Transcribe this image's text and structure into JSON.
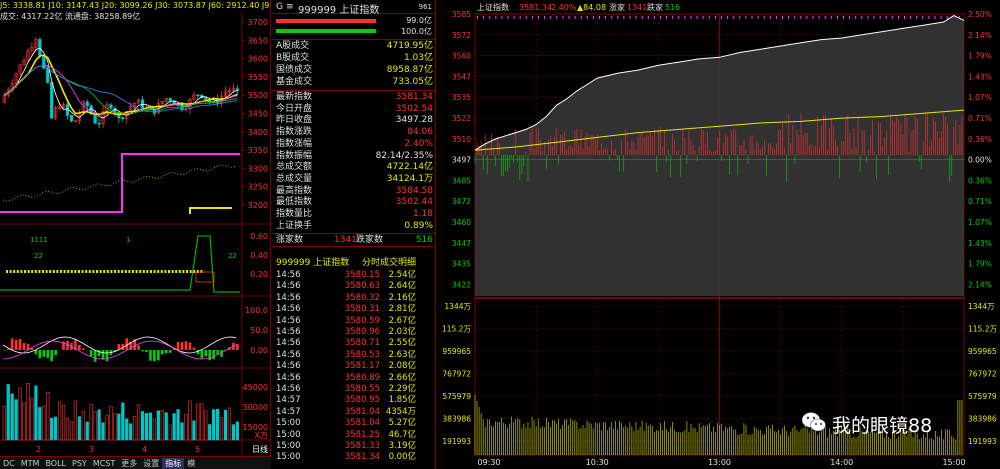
{
  "left": {
    "header_line1": "J5: 3338.81  J10: 3147.43  J20: 3099.26  J30: 3073.87  J60: 2912.40  J9",
    "header_line2": "成交: 4317.22亿 流通盘: 38258.89亿",
    "price_ticks": [
      "3700",
      "3650",
      "3600",
      "3550",
      "3500",
      "3450",
      "3400",
      "3350",
      "3300",
      "3250",
      "3200"
    ],
    "ind1_ticks": [
      "0.60",
      "0.40",
      "0.20"
    ],
    "ind1_labels": [
      "1111",
      "1",
      "22",
      "22"
    ],
    "ind2_ticks": [
      "100.0",
      "50.0",
      "0.00"
    ],
    "vol_ticks": [
      "45000",
      "30000",
      "15000"
    ],
    "vol_unit": "X万",
    "date_labels": [
      "2",
      "3",
      "4",
      "5"
    ],
    "side_label": "日线",
    "toolbar": [
      "DC",
      "MTM",
      "BOLL",
      "PSY",
      "MCST",
      "更多",
      "设置",
      "指标",
      "模"
    ]
  },
  "mid": {
    "code_title": "999999 上证指数",
    "badge": "G",
    "side_badge": "961",
    "bar_values": [
      "99.0亿",
      "100.0亿"
    ],
    "stats": [
      {
        "label": "A股成交",
        "value": "4719.95亿",
        "color": "yellow"
      },
      {
        "label": "B股成交",
        "value": "1.03亿",
        "color": "yellow"
      },
      {
        "label": "国债成交",
        "value": "8958.87亿",
        "color": "yellow"
      },
      {
        "label": "基金成交",
        "value": "733.05亿",
        "color": "yellow"
      }
    ],
    "quote": [
      {
        "label": "最新指数",
        "value": "3581.34",
        "color": "red"
      },
      {
        "label": "今日开盘",
        "value": "3502.54",
        "color": "red"
      },
      {
        "label": "昨日收盘",
        "value": "3497.28",
        "color": "white"
      },
      {
        "label": "指数涨跌",
        "value": "84.06",
        "color": "red"
      },
      {
        "label": "指数涨幅",
        "value": "2.40%",
        "color": "red"
      },
      {
        "label": "指数振幅",
        "value": "82.14/2.35%",
        "color": "white"
      },
      {
        "label": "总成交额",
        "value": "4722.14亿",
        "color": "yellow"
      },
      {
        "label": "总成交量",
        "value": "34124.1万",
        "color": "yellow"
      },
      {
        "label": "最高指数",
        "value": "3584.58",
        "color": "red"
      },
      {
        "label": "最低指数",
        "value": "3502.44",
        "color": "red"
      },
      {
        "label": "指数量比",
        "value": "1.18",
        "color": "red"
      },
      {
        "label": "上证换手",
        "value": "0.89%",
        "color": "yellow"
      }
    ],
    "updown": {
      "up_label": "涨家数",
      "up_value": "1341",
      "down_label": "跌家数",
      "down_value": "516"
    },
    "detail_title": "999999 上证指数",
    "detail_subtitle": "分时成交明细",
    "ticks": [
      {
        "t": "14:56",
        "p": "3580.15",
        "v": "2.54亿"
      },
      {
        "t": "14:56",
        "p": "3580.63",
        "v": "2.64亿"
      },
      {
        "t": "14:56",
        "p": "3580.32",
        "v": "2.16亿"
      },
      {
        "t": "14:56",
        "p": "3580.31",
        "v": "2.81亿"
      },
      {
        "t": "14:56",
        "p": "3580.59",
        "v": "2.67亿"
      },
      {
        "t": "14:56",
        "p": "3580.96",
        "v": "2.03亿"
      },
      {
        "t": "14:56",
        "p": "3580.71",
        "v": "2.55亿"
      },
      {
        "t": "14:56",
        "p": "3580.53",
        "v": "2.63亿"
      },
      {
        "t": "14:56",
        "p": "3581.17",
        "v": "2.08亿"
      },
      {
        "t": "14:56",
        "p": "3580.89",
        "v": "2.66亿"
      },
      {
        "t": "14:56",
        "p": "3580.55",
        "v": "2.29亿"
      },
      {
        "t": "14:57",
        "p": "3580.95",
        "v": "1.85亿"
      },
      {
        "t": "14:57",
        "p": "3581.04",
        "v": "4354万"
      },
      {
        "t": "15:00",
        "p": "3581.04",
        "v": "5.27亿"
      },
      {
        "t": "15:00",
        "p": "3581.25",
        "v": "46.7亿"
      },
      {
        "t": "15:00",
        "p": "3581.33",
        "v": "3.19亿"
      },
      {
        "t": "15:00",
        "p": "3581.34",
        "v": "0.00亿"
      }
    ]
  },
  "chart_data": {
    "type": "line",
    "title": "上证指数",
    "header": {
      "name": "上证指数",
      "last": "3581.34",
      "pct": "2.40%",
      "chg": "84.08",
      "up_label": "涨家",
      "up": "1341",
      "down_label": "跌家",
      "down": "516"
    },
    "prev_close": 3497,
    "y_left_ticks": [
      "3585",
      "3572",
      "3560",
      "3547",
      "3535",
      "3522",
      "3510",
      "3497",
      "3485",
      "3472",
      "3460",
      "3447",
      "3435",
      "3422"
    ],
    "y_right_ticks": [
      "2.50%",
      "2.14%",
      "1.79%",
      "1.43%",
      "1.07%",
      "0.71%",
      "0.36%",
      "0.00%",
      "0.36%",
      "0.71%",
      "1.07%",
      "1.43%",
      "1.79%",
      "2.14%"
    ],
    "ylim": [
      3409,
      3585
    ],
    "vol_ticks": [
      "1344万",
      "115.2万",
      "959965",
      "767972",
      "575979",
      "383986",
      "191993"
    ],
    "x_labels": [
      "09:30",
      "10:30",
      "13:00",
      "14:00",
      "15:00"
    ],
    "series": [
      {
        "color": "#ffffff",
        "points": [
          [
            0,
            3500
          ],
          [
            5,
            3504
          ],
          [
            10,
            3507
          ],
          [
            15,
            3509
          ],
          [
            20,
            3511
          ],
          [
            25,
            3513
          ],
          [
            30,
            3516
          ],
          [
            35,
            3521
          ],
          [
            40,
            3528
          ],
          [
            45,
            3532
          ],
          [
            50,
            3537
          ],
          [
            55,
            3541
          ],
          [
            60,
            3545
          ],
          [
            70,
            3548
          ],
          [
            80,
            3550
          ],
          [
            90,
            3553
          ],
          [
            100,
            3555
          ],
          [
            110,
            3557
          ],
          [
            120,
            3558
          ],
          [
            130,
            3561
          ],
          [
            140,
            3563
          ],
          [
            150,
            3565
          ],
          [
            160,
            3567
          ],
          [
            170,
            3569
          ],
          [
            180,
            3570
          ],
          [
            190,
            3572
          ],
          [
            200,
            3574
          ],
          [
            210,
            3576
          ],
          [
            220,
            3578
          ],
          [
            230,
            3580
          ],
          [
            235,
            3584
          ],
          [
            240,
            3581
          ]
        ]
      },
      {
        "color": "#e8e800",
        "points": [
          [
            0,
            3500
          ],
          [
            20,
            3502
          ],
          [
            40,
            3505
          ],
          [
            60,
            3508
          ],
          [
            80,
            3511
          ],
          [
            100,
            3513
          ],
          [
            120,
            3515
          ],
          [
            140,
            3517
          ],
          [
            160,
            3518
          ],
          [
            180,
            3520
          ],
          [
            200,
            3521
          ],
          [
            220,
            3523
          ],
          [
            240,
            3525
          ]
        ]
      }
    ]
  },
  "watermark": "我的眼镜88"
}
